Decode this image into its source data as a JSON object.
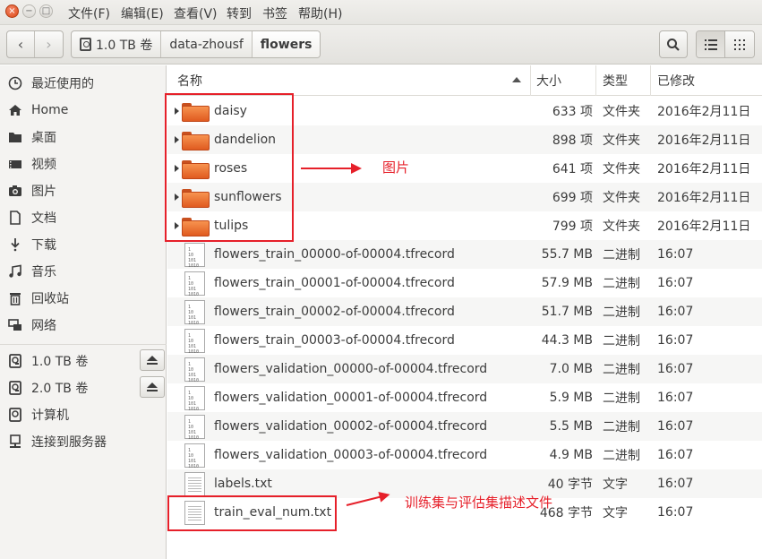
{
  "window": {
    "controls": {
      "close": "×",
      "minimize": "−",
      "maximize": "□"
    }
  },
  "menubar": {
    "items": [
      "文件(F)",
      "编辑(E)",
      "查看(V)",
      "转到",
      "书签",
      "帮助(H)"
    ]
  },
  "toolbar": {
    "back_glyph": "‹",
    "forward_glyph": "›",
    "breadcrumbs": [
      "1.0 TB 卷",
      "data-zhousf",
      "flowers"
    ]
  },
  "sidebar": {
    "places": [
      {
        "label": "最近使用的",
        "icon": "clock-icon"
      },
      {
        "label": "Home",
        "icon": "home-icon"
      },
      {
        "label": "桌面",
        "icon": "desktop-folder-icon"
      },
      {
        "label": "视频",
        "icon": "video-icon"
      },
      {
        "label": "图片",
        "icon": "camera-icon"
      },
      {
        "label": "文档",
        "icon": "document-icon"
      },
      {
        "label": "下载",
        "icon": "download-icon"
      },
      {
        "label": "音乐",
        "icon": "music-icon"
      },
      {
        "label": "回收站",
        "icon": "trash-icon"
      },
      {
        "label": "网络",
        "icon": "network-icon"
      }
    ],
    "devices": [
      {
        "label": "1.0 TB 卷",
        "icon": "drive-icon",
        "eject": true
      },
      {
        "label": "2.0 TB 卷",
        "icon": "drive-icon",
        "eject": true
      },
      {
        "label": "计算机",
        "icon": "computer-icon",
        "eject": false
      },
      {
        "label": "连接到服务器",
        "icon": "server-icon",
        "eject": false
      }
    ]
  },
  "columns": {
    "name": "名称",
    "size": "大小",
    "type": "类型",
    "modified": "已修改"
  },
  "files": [
    {
      "name": "daisy",
      "size": "633 项",
      "type": "文件夹",
      "modified": "2016年2月11日",
      "kind": "folder"
    },
    {
      "name": "dandelion",
      "size": "898 项",
      "type": "文件夹",
      "modified": "2016年2月11日",
      "kind": "folder"
    },
    {
      "name": "roses",
      "size": "641 项",
      "type": "文件夹",
      "modified": "2016年2月11日",
      "kind": "folder"
    },
    {
      "name": "sunflowers",
      "size": "699 项",
      "type": "文件夹",
      "modified": "2016年2月11日",
      "kind": "folder"
    },
    {
      "name": "tulips",
      "size": "799 项",
      "type": "文件夹",
      "modified": "2016年2月11日",
      "kind": "folder"
    },
    {
      "name": "flowers_train_00000-of-00004.tfrecord",
      "size": "55.7 MB",
      "type": "二进制",
      "modified": "16:07",
      "kind": "binary"
    },
    {
      "name": "flowers_train_00001-of-00004.tfrecord",
      "size": "57.9 MB",
      "type": "二进制",
      "modified": "16:07",
      "kind": "binary"
    },
    {
      "name": "flowers_train_00002-of-00004.tfrecord",
      "size": "51.7 MB",
      "type": "二进制",
      "modified": "16:07",
      "kind": "binary"
    },
    {
      "name": "flowers_train_00003-of-00004.tfrecord",
      "size": "44.3 MB",
      "type": "二进制",
      "modified": "16:07",
      "kind": "binary"
    },
    {
      "name": "flowers_validation_00000-of-00004.tfrecord",
      "size": "7.0 MB",
      "type": "二进制",
      "modified": "16:07",
      "kind": "binary"
    },
    {
      "name": "flowers_validation_00001-of-00004.tfrecord",
      "size": "5.9 MB",
      "type": "二进制",
      "modified": "16:07",
      "kind": "binary"
    },
    {
      "name": "flowers_validation_00002-of-00004.tfrecord",
      "size": "5.5 MB",
      "type": "二进制",
      "modified": "16:07",
      "kind": "binary"
    },
    {
      "name": "flowers_validation_00003-of-00004.tfrecord",
      "size": "4.9 MB",
      "type": "二进制",
      "modified": "16:07",
      "kind": "binary"
    },
    {
      "name": "labels.txt",
      "size": "40 字节",
      "type": "文字",
      "modified": "16:07",
      "kind": "text"
    },
    {
      "name": "train_eval_num.txt",
      "size": "468 字节",
      "type": "文字",
      "modified": "16:07",
      "kind": "text"
    }
  ],
  "annotations": {
    "images_label": "图片",
    "desc_label": "训练集与评估集描述文件",
    "color": "#e6202a"
  },
  "icon_glyphs": {
    "binary": "1\n10\n101\n1010"
  }
}
